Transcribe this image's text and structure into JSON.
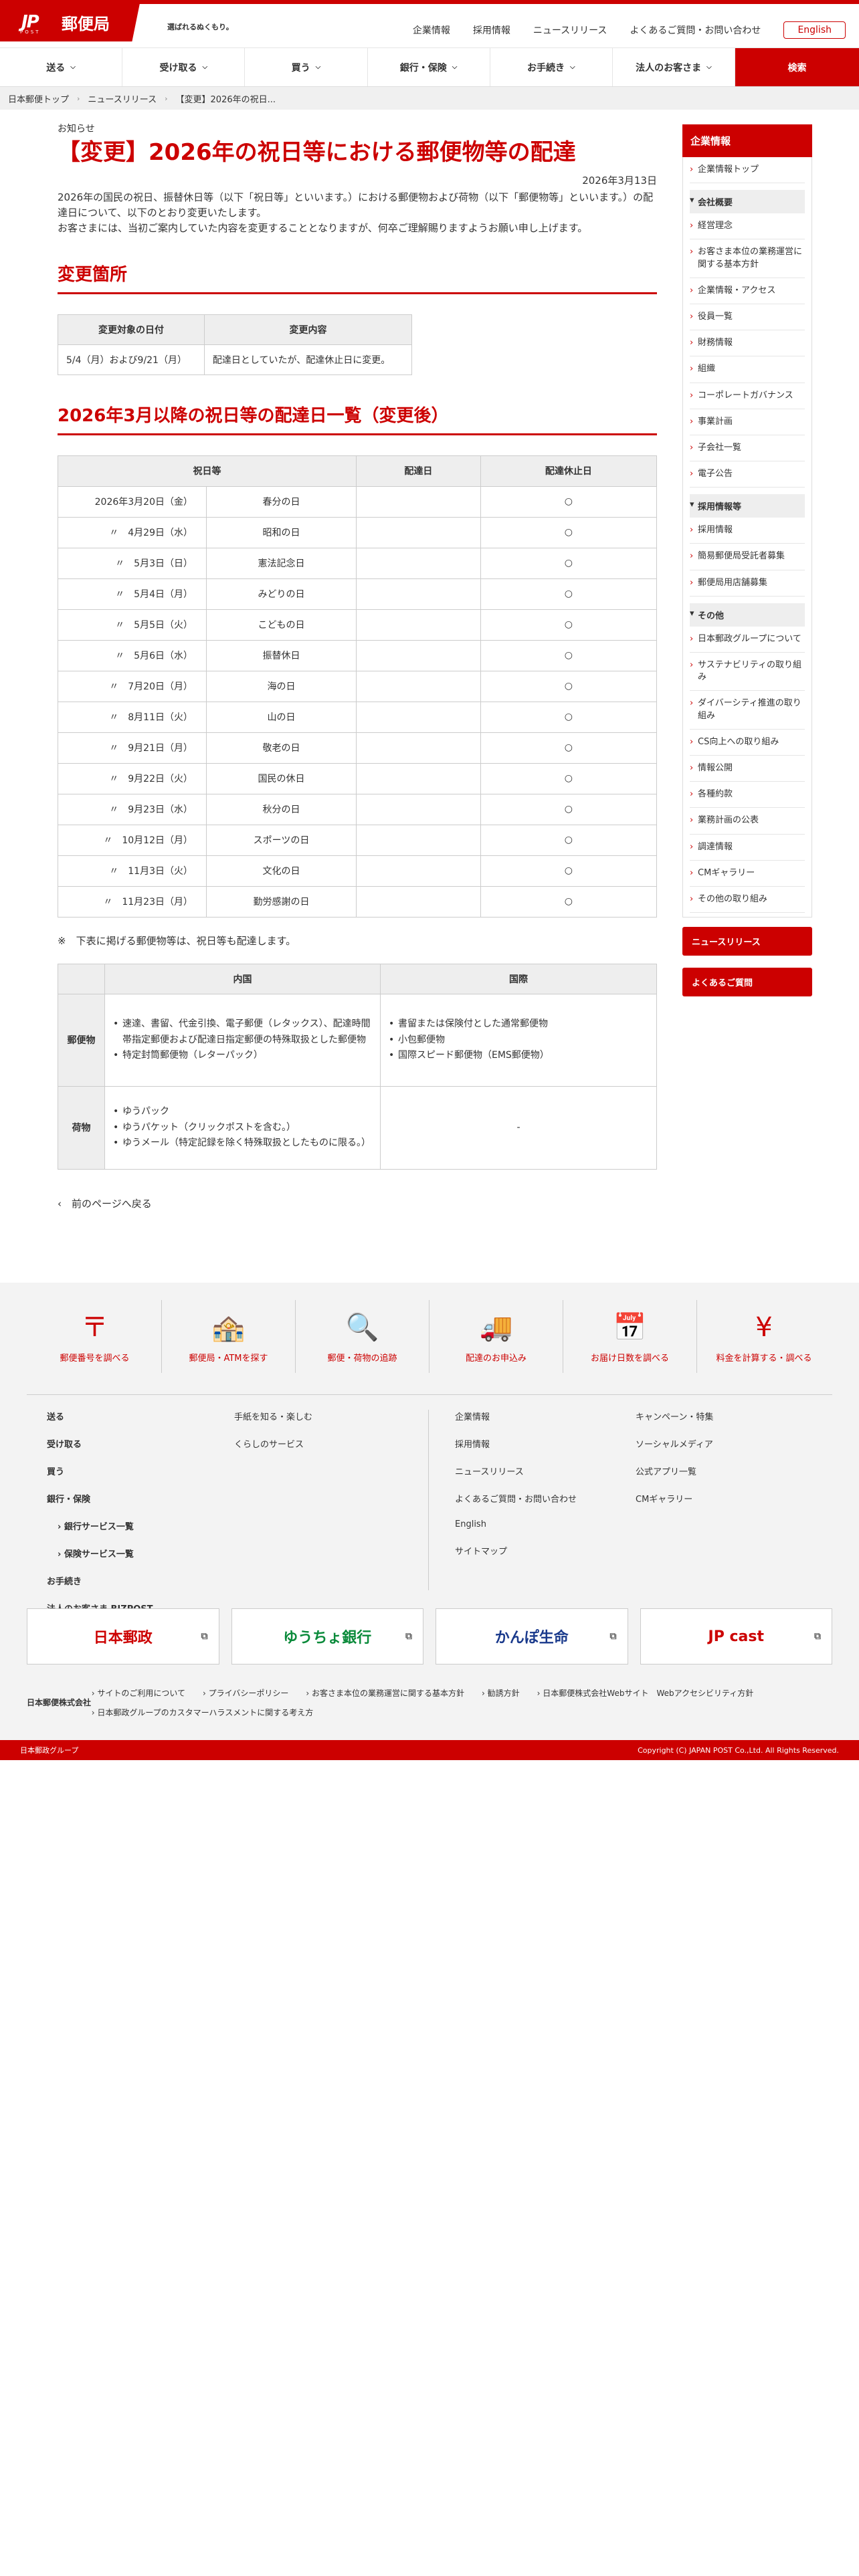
{
  "header": {
    "logo_mark": "JP",
    "logo_sub": "POST",
    "logo_name": "郵便局",
    "tagline": "選ばれるぬくもり。",
    "utility": [
      "企業情報",
      "採用情報",
      "ニュースリリース",
      "よくあるご質問・お問い合わせ"
    ],
    "english": "English"
  },
  "gnav": {
    "items": [
      "送る",
      "受け取る",
      "買う",
      "銀行・保険",
      "お手続き",
      "法人のお客さま"
    ],
    "search": "検索"
  },
  "breadcrumb": [
    "日本郵便トップ",
    "ニュースリリース",
    "【変更】2026年の祝日..."
  ],
  "article": {
    "kicker": "お知らせ",
    "title": "【変更】2026年の祝日等における郵便物等の配達",
    "date": "2026年3月13日",
    "lead1": "2026年の国民の祝日、振替休日等（以下「祝日等」といいます。）における郵便物および荷物（以下「郵便物等」といいます。）の配達日について、以下のとおり変更いたします。",
    "lead2": "お客さまには、当初ご案内していた内容を変更することとなりますが、何卒ご理解賜りますようお願い申し上げます。",
    "section1": "変更箇所",
    "change_table": {
      "headers": [
        "変更対象の日付",
        "変更内容"
      ],
      "row": [
        "5/4（月）および9/21（月）",
        "配達日としていたが、配達休止日に変更。"
      ]
    },
    "section2": "2026年3月以降の祝日等の配達日一覧（変更後）",
    "holiday_headers": [
      "祝日等",
      "配達日",
      "配達休止日"
    ],
    "holidays": [
      {
        "date": "2026年3月20日（金）",
        "name": "春分の日",
        "off": "○"
      },
      {
        "date": "〃　4月29日（水）",
        "name": "昭和の日",
        "off": "○"
      },
      {
        "date": "〃　5月3日（日）",
        "name": "憲法記念日",
        "off": "○"
      },
      {
        "date": "〃　5月4日（月）",
        "name": "みどりの日",
        "off": "○"
      },
      {
        "date": "〃　5月5日（火）",
        "name": "こどもの日",
        "off": "○"
      },
      {
        "date": "〃　5月6日（水）",
        "name": "振替休日",
        "off": "○"
      },
      {
        "date": "〃　7月20日（月）",
        "name": "海の日",
        "off": "○"
      },
      {
        "date": "〃　8月11日（火）",
        "name": "山の日",
        "off": "○"
      },
      {
        "date": "〃　9月21日（月）",
        "name": "敬老の日",
        "off": "○"
      },
      {
        "date": "〃　9月22日（火）",
        "name": "国民の休日",
        "off": "○"
      },
      {
        "date": "〃　9月23日（水）",
        "name": "秋分の日",
        "off": "○"
      },
      {
        "date": "〃　10月12日（月）",
        "name": "スポーツの日",
        "off": "○"
      },
      {
        "date": "〃　11月3日（火）",
        "name": "文化の日",
        "off": "○"
      },
      {
        "date": "〃　11月23日（月）",
        "name": "勤労感謝の日",
        "off": "○"
      }
    ],
    "note": "※　下表に掲げる郵便物等は、祝日等も配達します。",
    "mail_table": {
      "headers": [
        "内国",
        "国際"
      ],
      "row1_label": "郵便物",
      "row1_domestic": [
        "速達、書留、代金引換、電子郵便（レタックス）、配達時間帯指定郵便および配達日指定郵便の特殊取扱とした郵便物",
        "特定封筒郵便物（レターパック）"
      ],
      "row1_intl": [
        "書留または保険付とした通常郵便物",
        "小包郵便物",
        "国際スピード郵便物（EMS郵便物）"
      ],
      "row2_label": "荷物",
      "row2_domestic": [
        "ゆうパック",
        "ゆうパケット（クリックポストを含む。）",
        "ゆうメール（特定記録を除く特殊取扱としたものに限る。）"
      ],
      "row2_intl": "-"
    },
    "back": "前のページへ戻る"
  },
  "sidebar": {
    "head": "企業情報",
    "top": "企業情報トップ",
    "group1": "会社概要",
    "group1_items": [
      "経営理念",
      "お客さま本位の業務運営に関する基本方針",
      "企業情報・アクセス",
      "役員一覧",
      "財務情報",
      "組織",
      "コーポレートガバナンス",
      "事業計画",
      "子会社一覧",
      "電子公告"
    ],
    "group2": "採用情報等",
    "group2_items": [
      "採用情報",
      "簡易郵便局受託者募集",
      "郵便局用店舗募集"
    ],
    "group3": "その他",
    "group3_items": [
      "日本郵政グループについて",
      "サステナビリティの取り組み",
      "ダイバーシティ推進の取り組み",
      "CS向上への取り組み",
      "情報公開",
      "各種約款",
      "業務計画の公表",
      "調達情報",
      "CMギャラリー",
      "その他の取り組み"
    ],
    "btn1": "ニュースリリース",
    "btn2": "よくあるご質問"
  },
  "footer": {
    "icons": [
      {
        "label": "郵便番号を調べる",
        "icon": "〒"
      },
      {
        "label": "郵便局・ATMを探す",
        "icon": "🏤"
      },
      {
        "label": "郵便・荷物の追跡",
        "icon": "🔍"
      },
      {
        "label": "配達のお申込み",
        "icon": "🚚"
      },
      {
        "label": "お届け日数を調べる",
        "icon": "📅"
      },
      {
        "label": "料金を計算する・調べる",
        "icon": "¥"
      }
    ],
    "col1": [
      "送る",
      "受け取る",
      "買う",
      "銀行・保険"
    ],
    "col1_sub": [
      "銀行サービス一覧",
      "保険サービス一覧"
    ],
    "col1_more": [
      "お手続き",
      "法人のお客さま BIZPOST"
    ],
    "col2": [
      "手紙を知る・楽しむ",
      "くらしのサービス"
    ],
    "col3": [
      "企業情報",
      "採用情報",
      "ニュースリリース",
      "よくあるご質問・お問い合わせ",
      "English",
      "サイトマップ"
    ],
    "col4": [
      "キャンペーン・特集",
      "ソーシャルメディア",
      "公式アプリ一覧",
      "CMギャラリー"
    ],
    "banners": [
      "日本郵政",
      "ゆうちょ銀行",
      "かんぽ生命",
      "JP cast"
    ],
    "corp": "日本郵便株式会社",
    "legal": [
      "サイトのご利用について",
      "プライバシーポリシー",
      "お客さま本位の業務運営に関する基本方針",
      "勧誘方針",
      "日本郵便株式会社Webサイト　Webアクセシビリティ方針",
      "日本郵政グループのカスタマーハラスメントに関する考え方"
    ],
    "group": "日本郵政グループ",
    "copyright": "Copyright (C) JAPAN POST Co.,Ltd.  All Rights Reserved."
  }
}
